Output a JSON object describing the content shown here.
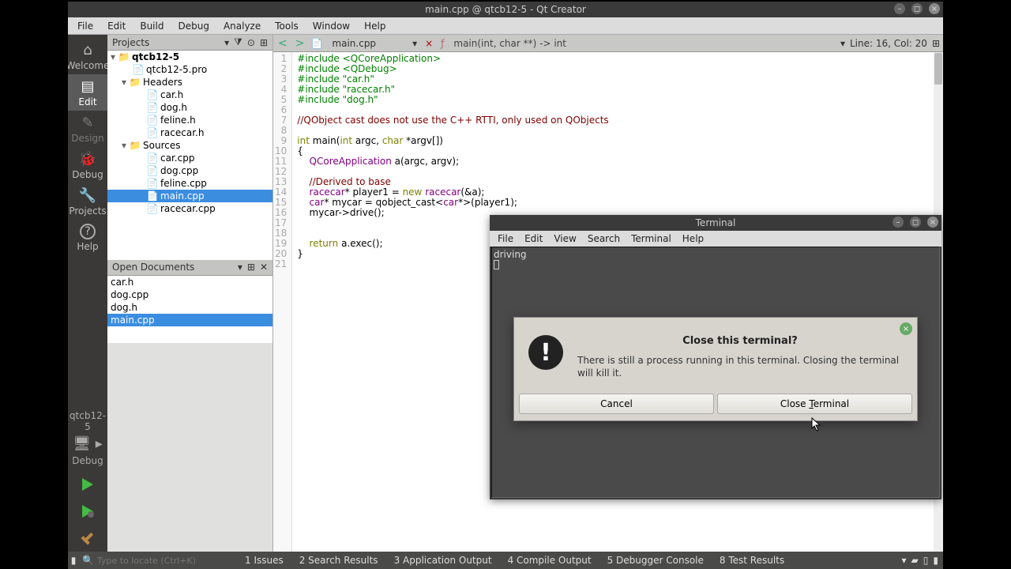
{
  "window": {
    "title": "main.cpp @ qtcb12-5 - Qt Creator"
  },
  "menubar": [
    "File",
    "Edit",
    "Build",
    "Debug",
    "Analyze",
    "Tools",
    "Window",
    "Help"
  ],
  "leftbar": [
    {
      "label": "Welcome",
      "icon": "⌂"
    },
    {
      "label": "Edit",
      "icon": "▤",
      "active": true
    },
    {
      "label": "Design",
      "icon": "✎",
      "disabled": true
    },
    {
      "label": "Debug",
      "icon": "🐞"
    },
    {
      "label": "Projects",
      "icon": "🔧"
    },
    {
      "label": "Help",
      "icon": "?"
    }
  ],
  "leftbar_bottom": {
    "project": "qtcb12-5",
    "config": "Debug"
  },
  "projects": {
    "header": "Projects",
    "root": "qtcb12-5",
    "pro": "qtcb12-5.pro",
    "headers_label": "Headers",
    "headers": [
      "car.h",
      "dog.h",
      "feline.h",
      "racecar.h"
    ],
    "sources_label": "Sources",
    "sources": [
      "car.cpp",
      "dog.cpp",
      "feline.cpp",
      "main.cpp",
      "racecar.cpp"
    ],
    "selected": "main.cpp"
  },
  "open_docs": {
    "header": "Open Documents",
    "items": [
      "car.h",
      "dog.cpp",
      "dog.h",
      "main.cpp"
    ],
    "selected": "main.cpp"
  },
  "editor_tab": {
    "filename": "main.cpp",
    "func_sig": "main(int, char **) -> int",
    "linecol": "Line: 16, Col: 20"
  },
  "code_lines": [
    {
      "n": 1,
      "html": "<span class=c-pp>#include</span> <span class=c-str>&lt;QCoreApplication&gt;</span>"
    },
    {
      "n": 2,
      "html": "<span class=c-pp>#include</span> <span class=c-str>&lt;QDebug&gt;</span>"
    },
    {
      "n": 3,
      "html": "<span class=c-pp>#include</span> <span class=c-str>\"car.h\"</span>"
    },
    {
      "n": 4,
      "html": "<span class=c-pp>#include</span> <span class=c-str>\"racecar.h\"</span>"
    },
    {
      "n": 5,
      "html": "<span class=c-pp>#include</span> <span class=c-str>\"dog.h\"</span>"
    },
    {
      "n": 6,
      "html": ""
    },
    {
      "n": 7,
      "html": "<span class=c-cmt>//QObject cast does not use the C++ RTTI, only used on QObjects</span>"
    },
    {
      "n": 8,
      "html": ""
    },
    {
      "n": 9,
      "html": "<span class=c-kw>int</span> <span class=c-func>main</span>(<span class=c-kw>int</span> argc, <span class=c-kw>char</span> *argv[])"
    },
    {
      "n": 10,
      "html": "{"
    },
    {
      "n": 11,
      "html": "    <span class=c-type>QCoreApplication</span> a(argc, argv);"
    },
    {
      "n": 12,
      "html": ""
    },
    {
      "n": 13,
      "html": "    <span class=c-cmt>//Derived to base</span>"
    },
    {
      "n": 14,
      "html": "    <span class=c-type>racecar</span>* player1 = <span class=c-kw>new</span> <span class=c-type>racecar</span>(&amp;a);"
    },
    {
      "n": 15,
      "html": "    <span class=c-type>car</span>* mycar = <span class=c-func>qobject_cast</span>&lt;<span class=c-type>car</span>*&gt;(player1);"
    },
    {
      "n": 16,
      "html": "    mycar-&gt;<span class=c-func>drive</span>();"
    },
    {
      "n": 17,
      "html": ""
    },
    {
      "n": 18,
      "html": ""
    },
    {
      "n": 19,
      "html": "    <span class=c-kw>return</span> a.<span class=c-func>exec</span>();"
    },
    {
      "n": 20,
      "html": "}"
    },
    {
      "n": 21,
      "html": ""
    }
  ],
  "bottombar": {
    "search_placeholder": "Type to locate (Ctrl+K)",
    "tabs": [
      "1   Issues",
      "2   Search Results",
      "3   Application Output",
      "4   Compile Output",
      "5   Debugger Console",
      "8   Test Results"
    ]
  },
  "terminal": {
    "title": "Terminal",
    "menu": [
      "File",
      "Edit",
      "View",
      "Search",
      "Terminal",
      "Help"
    ],
    "output": "driving"
  },
  "dialog": {
    "title": "Close this terminal?",
    "message": "There is still a process running in this terminal. Closing the terminal will kill it.",
    "cancel": "Cancel",
    "confirm": "Close Terminal"
  }
}
